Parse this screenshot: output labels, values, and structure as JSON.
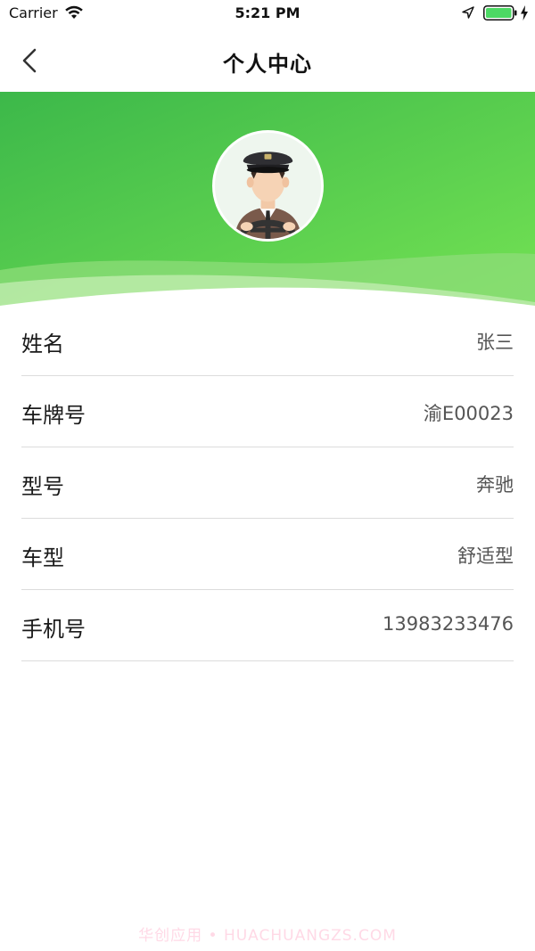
{
  "status_bar": {
    "carrier": "Carrier",
    "time": "5:21 PM",
    "icons": [
      "wifi-icon",
      "location-arrow-icon",
      "battery-icon",
      "charging-bolt-icon"
    ],
    "battery_color": "#4cd964"
  },
  "nav": {
    "title": "个人中心",
    "back_icon": "chevron-left-icon"
  },
  "banner": {
    "gradient_start": "#3dbb4a",
    "gradient_end": "#6ee04f",
    "avatar_icon": "driver-avatar-icon"
  },
  "profile": {
    "rows": [
      {
        "label": "姓名",
        "value": "张三"
      },
      {
        "label": "车牌号",
        "value": "渝E00023"
      },
      {
        "label": "型号",
        "value": "奔驰"
      },
      {
        "label": "车型",
        "value": "舒适型"
      },
      {
        "label": "手机号",
        "value": "13983233476"
      }
    ]
  },
  "watermark": "华创应用 • HUACHUANGZS.COM"
}
